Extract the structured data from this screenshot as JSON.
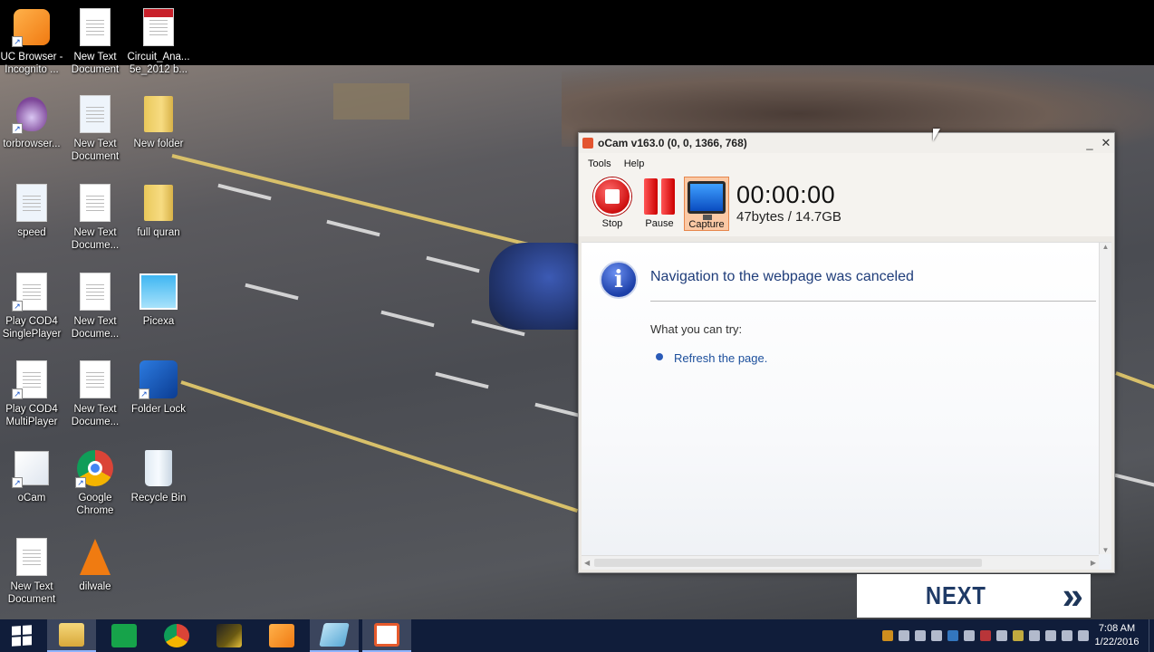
{
  "desktop": {
    "icons": [
      {
        "label": "UC Browser -\nIncognito ...",
        "icon": "uc-browser-icon"
      },
      {
        "label": "New Text\nDocument",
        "icon": "cpp-document-icon"
      },
      {
        "label": "Circuit_Ana...\n5e_2012 b...",
        "icon": "pdf-icon"
      },
      {
        "label": "torbrowser...",
        "icon": "tor-onion-icon"
      },
      {
        "label": "New Text\nDocument",
        "icon": "settings-document-icon"
      },
      {
        "label": "New folder",
        "icon": "folder-icon"
      },
      {
        "label": "speed",
        "icon": "settings-document-icon"
      },
      {
        "label": "New Text\nDocume...",
        "icon": "text-document-icon"
      },
      {
        "label": "full quran",
        "icon": "folder-icon"
      },
      {
        "label": "Play COD4\nSinglePlayer",
        "icon": "shortcut-document-icon"
      },
      {
        "label": "New Text\nDocume...",
        "icon": "crx-icon"
      },
      {
        "label": "Picexa",
        "icon": "picexa-icon"
      },
      {
        "label": "Play COD4\nMultiPlayer",
        "icon": "shortcut-document-icon"
      },
      {
        "label": "New Text\nDocume...",
        "icon": "text-document-icon"
      },
      {
        "label": "Folder Lock",
        "icon": "folder-lock-icon"
      },
      {
        "label": "oCam",
        "icon": "ocam-icon"
      },
      {
        "label": "Google\nChrome",
        "icon": "chrome-icon"
      },
      {
        "label": "Recycle Bin",
        "icon": "recycle-bin-icon"
      },
      {
        "label": "New Text\nDocument",
        "icon": "text-document-icon"
      },
      {
        "label": "dilwale",
        "icon": "vlc-icon"
      }
    ]
  },
  "ocam": {
    "title": "oCam v163.0 (0, 0, 1366, 768)",
    "minimize": "_",
    "close": "✕",
    "menu": {
      "tools": "Tools",
      "help": "Help"
    },
    "toolbar": {
      "stop": "Stop",
      "pause": "Pause",
      "capture": "Capture"
    },
    "timer": "00:00:00",
    "size": "47bytes / 14.7GB"
  },
  "browser": {
    "headline": "Navigation to the webpage was canceled",
    "try_label": "What you can try:",
    "refresh_link": "Refresh the page."
  },
  "banner": {
    "text": "NEXT",
    "chevrons": "»"
  },
  "taskbar": {
    "items": [
      "file-explorer",
      "store",
      "chrome",
      "game",
      "uc-browser",
      "tablet-app",
      "ocam"
    ],
    "time": "7:08 AM",
    "date": "1/22/2016"
  },
  "colors": {
    "taskbar": "#101d3a",
    "ocam_capture_active": "#fbc9a5",
    "link_blue": "#1c4f9c",
    "heading_blue": "#1f3d7a"
  }
}
